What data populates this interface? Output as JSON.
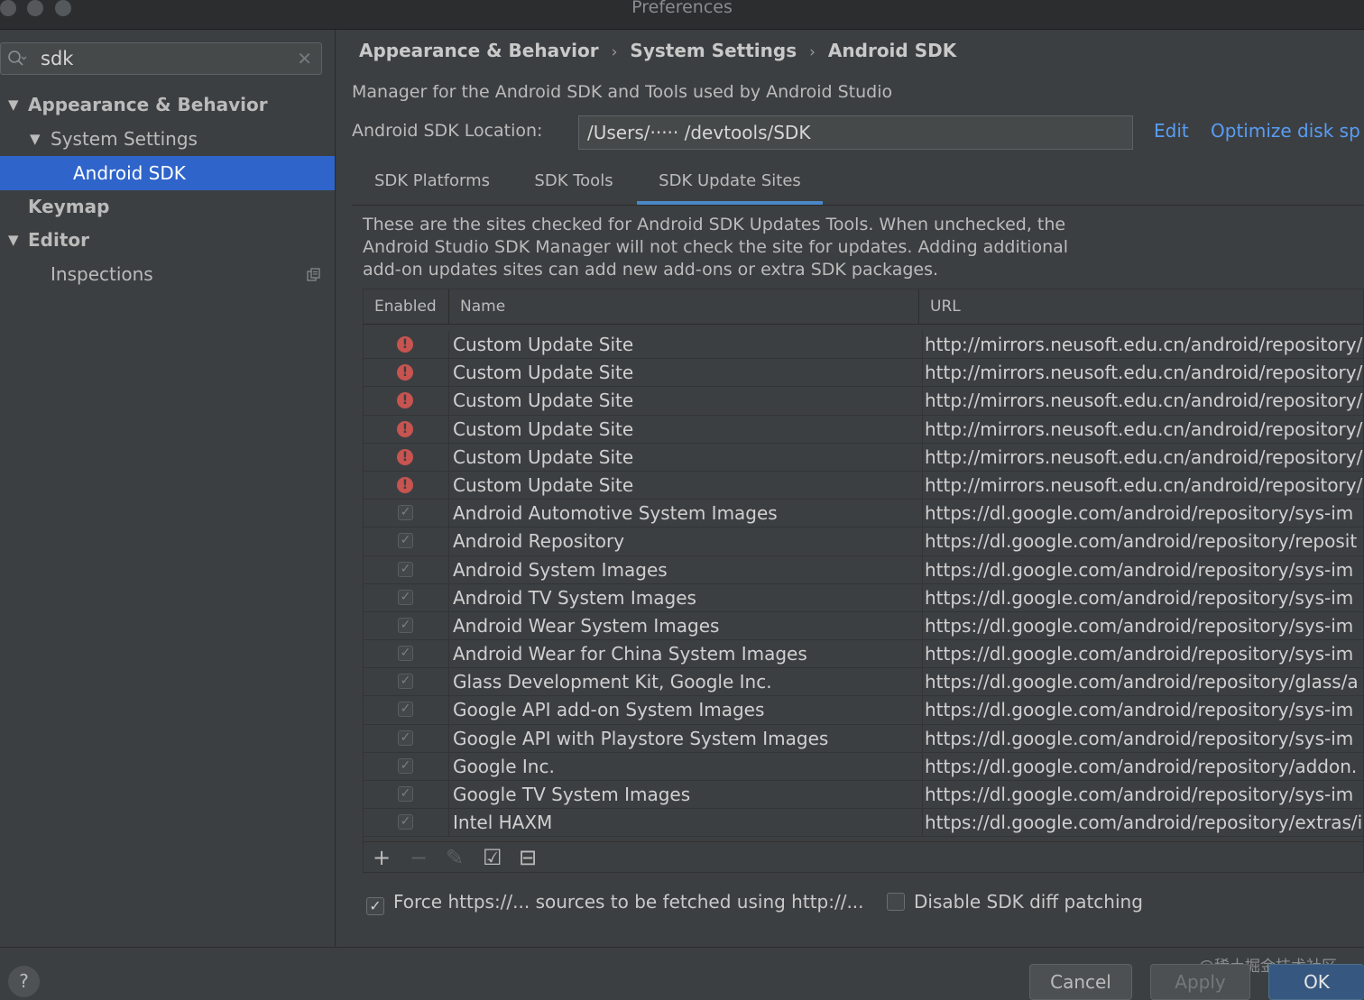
{
  "window": {
    "title": "Preferences"
  },
  "sidebar": {
    "search_value": "sdk",
    "search_icon": "search-icon",
    "tree": [
      {
        "label": "Appearance & Behavior"
      },
      {
        "label": "System Settings"
      },
      {
        "label": "Android SDK"
      },
      {
        "label": "Keymap"
      },
      {
        "label": "Editor"
      },
      {
        "label": "Inspections"
      }
    ]
  },
  "main": {
    "breadcrumb": [
      "Appearance & Behavior",
      "System Settings",
      "Android SDK"
    ],
    "description": "Manager for the Android SDK and Tools used by Android Studio",
    "location_label": "Android SDK Location:",
    "location_value": "/Users/·····  /devtools/SDK",
    "edit_link": "Edit",
    "optimize_link": "Optimize disk sp",
    "tabs": [
      "SDK Platforms",
      "SDK Tools",
      "SDK Update Sites"
    ],
    "active_tab": 2,
    "info_text": "These are the sites checked for Android SDK Updates Tools. When unchecked, the\nAndroid Studio SDK Manager will not check the site for updates. Adding additional\nadd-on updates sites can add new add-ons or extra SDK packages.",
    "table": {
      "headers": [
        "Enabled",
        "Name",
        "URL"
      ],
      "rows": [
        {
          "state": "error",
          "name": "Custom Update Site",
          "url": "http://mirrors.neusoft.edu.cn/android/repository/"
        },
        {
          "state": "error",
          "name": "Custom Update Site",
          "url": "http://mirrors.neusoft.edu.cn/android/repository/"
        },
        {
          "state": "error",
          "name": "Custom Update Site",
          "url": "http://mirrors.neusoft.edu.cn/android/repository/"
        },
        {
          "state": "error",
          "name": "Custom Update Site",
          "url": "http://mirrors.neusoft.edu.cn/android/repository/"
        },
        {
          "state": "error",
          "name": "Custom Update Site",
          "url": "http://mirrors.neusoft.edu.cn/android/repository/"
        },
        {
          "state": "error",
          "name": "Custom Update Site",
          "url": "http://mirrors.neusoft.edu.cn/android/repository/"
        },
        {
          "state": "checked",
          "name": "Android Automotive System Images",
          "url": "https://dl.google.com/android/repository/sys-im"
        },
        {
          "state": "checked",
          "name": "Android Repository",
          "url": "https://dl.google.com/android/repository/reposit"
        },
        {
          "state": "checked",
          "name": "Android System Images",
          "url": "https://dl.google.com/android/repository/sys-im"
        },
        {
          "state": "checked",
          "name": "Android TV System Images",
          "url": "https://dl.google.com/android/repository/sys-im"
        },
        {
          "state": "checked",
          "name": "Android Wear System Images",
          "url": "https://dl.google.com/android/repository/sys-im"
        },
        {
          "state": "checked",
          "name": "Android Wear for China System Images",
          "url": "https://dl.google.com/android/repository/sys-im"
        },
        {
          "state": "checked",
          "name": "Glass Development Kit, Google Inc.",
          "url": "https://dl.google.com/android/repository/glass/a"
        },
        {
          "state": "checked",
          "name": "Google API add-on System Images",
          "url": "https://dl.google.com/android/repository/sys-im"
        },
        {
          "state": "checked",
          "name": "Google API with Playstore System Images",
          "url": "https://dl.google.com/android/repository/sys-im"
        },
        {
          "state": "checked",
          "name": "Google Inc.",
          "url": "https://dl.google.com/android/repository/addon."
        },
        {
          "state": "checked",
          "name": "Google TV System Images",
          "url": "https://dl.google.com/android/repository/sys-im"
        },
        {
          "state": "checked",
          "name": "Intel HAXM",
          "url": "https://dl.google.com/android/repository/extras/i"
        }
      ]
    },
    "toolbar": {
      "add": "+",
      "remove": "−",
      "edit": "✎",
      "check_all": "☑",
      "uncheck_all": "⊟"
    },
    "options": {
      "force_http_label": "Force https://... sources to be fetched using http://...",
      "force_http_checked": true,
      "disable_diff_label": "Disable SDK diff patching",
      "disable_diff_checked": false
    }
  },
  "footer": {
    "help": "?",
    "cancel": "Cancel",
    "apply": "Apply",
    "ok": "OK",
    "watermark": "@稀土掘金技术社区"
  },
  "colors": {
    "selection": "#2f65ca",
    "link": "#589df6",
    "error": "#c75450",
    "ok_button": "#365880"
  }
}
